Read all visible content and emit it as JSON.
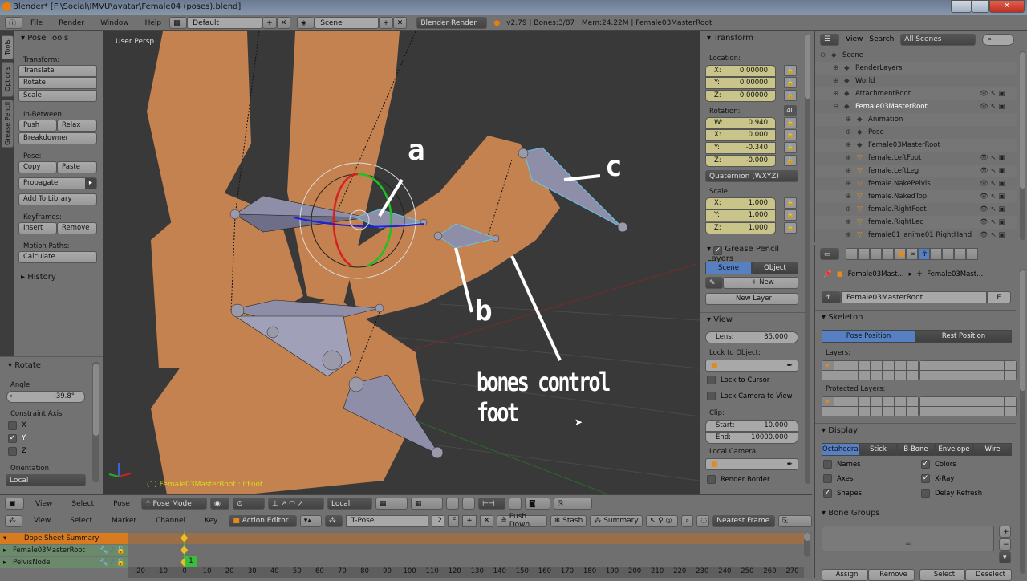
{
  "window": {
    "title": "Blender* [F:\\Social\\IMVU\\avatar\\Female04 (poses).blend]"
  },
  "infobar": {
    "menus": [
      "File",
      "Render",
      "Window",
      "Help"
    ],
    "screen_layout": "Default",
    "scene": "Scene",
    "render_engine": "Blender Render",
    "stats": "v2.79 | Bones:3/87 | Mem:24.22M | Female03MasterRoot"
  },
  "tool_tabs": [
    "Tools",
    "Options",
    "Grease Pencil"
  ],
  "toolshelf": {
    "title": "Pose Tools",
    "transform_label": "Transform:",
    "translate": "Translate",
    "rotate": "Rotate",
    "scale": "Scale",
    "inbetween_label": "In-Between:",
    "push": "Push",
    "relax": "Relax",
    "breakdowner": "Breakdowner",
    "pose_label": "Pose:",
    "copy": "Copy",
    "paste": "Paste",
    "propagate": "Propagate",
    "add_to_library": "Add To Library",
    "keyframes_label": "Keyframes:",
    "insert": "Insert",
    "remove": "Remove",
    "motion_paths_label": "Motion Paths:",
    "calculate": "Calculate",
    "history": "History"
  },
  "redo_panel": {
    "title": "Rotate",
    "angle_label": "Angle",
    "angle_value": "-39.8°",
    "constraint_label": "Constraint Axis",
    "axes": [
      {
        "label": "X",
        "checked": false
      },
      {
        "label": "Y",
        "checked": true
      },
      {
        "label": "Z",
        "checked": false
      }
    ],
    "orientation_label": "Orientation",
    "orientation_value": "Local"
  },
  "viewport": {
    "view_name": "User Persp",
    "status": "(1) Female03MasterRoot : lfFoot",
    "annotations": {
      "a": "a",
      "b": "b",
      "c": "c",
      "caption": "bones control foot"
    }
  },
  "npanel": {
    "transform_title": "Transform",
    "location_label": "Location:",
    "location": [
      {
        "k": "X:",
        "v": "0.00000"
      },
      {
        "k": "Y:",
        "v": "0.00000"
      },
      {
        "k": "Z:",
        "v": "0.00000"
      }
    ],
    "rotation_label": "Rotation:",
    "rotation_lock_mode": "4L",
    "rotation": [
      {
        "k": "W:",
        "v": "0.940"
      },
      {
        "k": "X:",
        "v": "0.000"
      },
      {
        "k": "Y:",
        "v": "-0.340"
      },
      {
        "k": "Z:",
        "v": "-0.000"
      }
    ],
    "rotation_mode": "Quaternion (WXYZ)",
    "scale_label": "Scale:",
    "scale": [
      {
        "k": "X:",
        "v": "1.000"
      },
      {
        "k": "Y:",
        "v": "1.000"
      },
      {
        "k": "Z:",
        "v": "1.000"
      }
    ],
    "gp_title": "Grease Pencil Layers",
    "gp_scene": "Scene",
    "gp_object": "Object",
    "gp_new": "New",
    "gp_new_layer": "New Layer",
    "view_title": "View",
    "lens_label": "Lens:",
    "lens_value": "35.000",
    "lock_object_label": "Lock to Object:",
    "lock_cursor": "Lock to Cursor",
    "lock_camera": "Lock Camera to View",
    "clip_label": "Clip:",
    "clip_start_label": "Start:",
    "clip_start": "10.000",
    "clip_end_label": "End:",
    "clip_end": "10000.000",
    "local_camera_label": "Local Camera:",
    "render_border": "Render Border"
  },
  "outliner": {
    "menus": [
      "View",
      "Search"
    ],
    "filter": "All Scenes",
    "rows": [
      {
        "label": "Scene",
        "indent": 0
      },
      {
        "label": "RenderLayers",
        "indent": 1
      },
      {
        "label": "World",
        "indent": 1
      },
      {
        "label": "AttachmentRoot",
        "indent": 1
      },
      {
        "label": "Female03MasterRoot",
        "indent": 1
      },
      {
        "label": "Animation",
        "indent": 2
      },
      {
        "label": "Pose",
        "indent": 2
      },
      {
        "label": "Female03MasterRoot",
        "indent": 2
      },
      {
        "label": "female.LeftFoot",
        "indent": 2
      },
      {
        "label": "female.LeftLeg",
        "indent": 2
      },
      {
        "label": "female.NakePelvis",
        "indent": 2
      },
      {
        "label": "female.NakedTop",
        "indent": 2
      },
      {
        "label": "female.RightFoot",
        "indent": 2
      },
      {
        "label": "female.RightLeg",
        "indent": 2
      },
      {
        "label": "female01_anime01 RightHand",
        "indent": 2
      }
    ]
  },
  "properties": {
    "breadcrumb": [
      "Female03Mast...",
      "Female03Mast..."
    ],
    "armature_name": "Female03MasterRoot",
    "fake_user": "F",
    "skeleton_title": "Skeleton",
    "pose_position": "Pose Position",
    "rest_position": "Rest Position",
    "layers_label": "Layers:",
    "protected_layers_label": "Protected Layers:",
    "display_title": "Display",
    "display_modes": [
      "Octahedral",
      "Stick",
      "B-Bone",
      "Envelope",
      "Wire"
    ],
    "display_active": "Octahedral",
    "options": [
      {
        "label": "Names",
        "checked": false
      },
      {
        "label": "Colors",
        "checked": true
      },
      {
        "label": "Axes",
        "checked": false
      },
      {
        "label": "X-Ray",
        "checked": true
      },
      {
        "label": "Shapes",
        "checked": true
      },
      {
        "label": "Delay Refresh",
        "checked": false
      }
    ],
    "bone_groups_title": "Bone Groups",
    "assign": "Assign",
    "remove": "Remove",
    "select": "Select",
    "deselect": "Deselect"
  },
  "view3d_header": {
    "menus": [
      "View",
      "Select",
      "Pose"
    ],
    "mode": "Pose Mode",
    "orientation": "Local"
  },
  "dopesheet": {
    "menus": [
      "View",
      "Select",
      "Marker",
      "Channel",
      "Key"
    ],
    "editor_mode": "Action Editor",
    "action": "T-Pose",
    "users": "2",
    "fake_user": "F",
    "push_down": "Push Down",
    "stash": "Stash",
    "summary": "Summary",
    "snap": "Nearest Frame",
    "channels": [
      "Dope Sheet Summary",
      "Female03MasterRoot",
      "PelvisNode"
    ],
    "current_frame": "1",
    "ruler": [
      "-20",
      "-10",
      "0",
      "10",
      "20",
      "30",
      "40",
      "50",
      "60",
      "70",
      "80",
      "90",
      "100",
      "110",
      "120",
      "130",
      "140",
      "150",
      "160",
      "170",
      "180",
      "190",
      "200",
      "210",
      "220",
      "230",
      "240",
      "250",
      "260",
      "270"
    ]
  },
  "colors": {
    "accent_blue": "#5680c2",
    "summary_orange": "#d87a1e",
    "playhead_green": "#3cbc3c",
    "skin": "#c3824f"
  }
}
